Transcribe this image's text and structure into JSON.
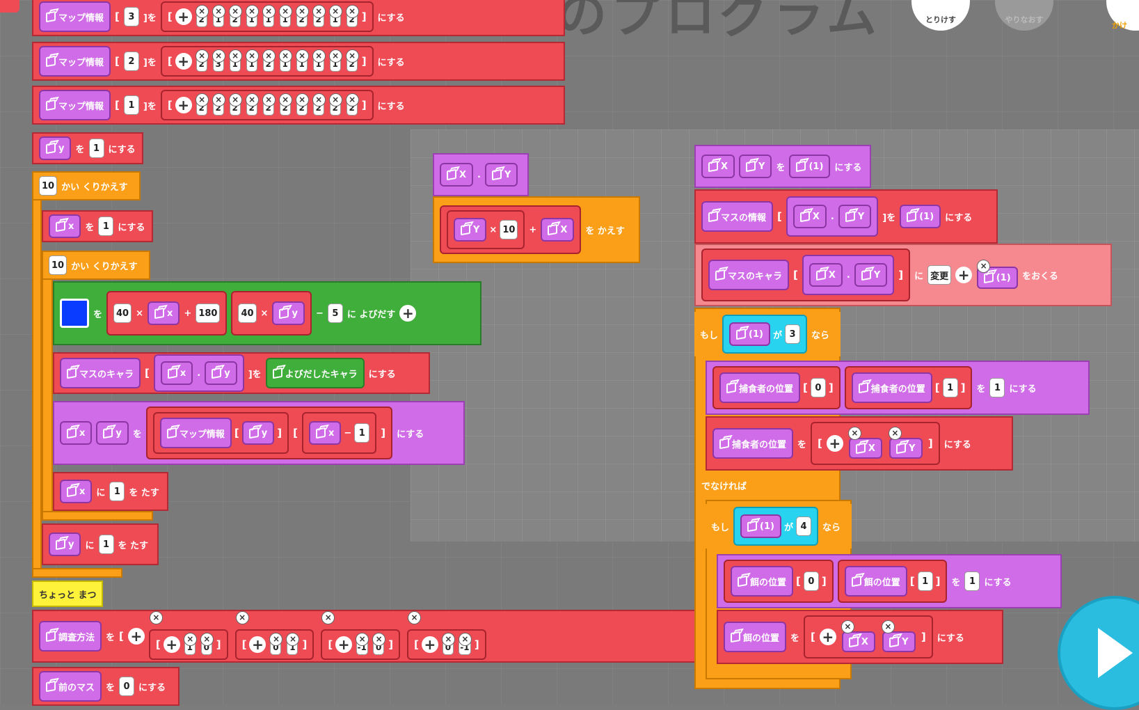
{
  "header": {
    "title": "のプログラム",
    "undo_label": "とりけす",
    "redo_label": "やりなおす",
    "right_label": "かけ"
  },
  "labels": {
    "map_info": "マップ情報",
    "set_wo": "]を",
    "nisuru": "にする",
    "repeat": "かい くりかえす",
    "wo": "を",
    "ni": "に",
    "wo_tasu": "を たす",
    "yobidasu": "に よびだす",
    "masu_chara": "マスのキャラ",
    "yobidashita": "よびだしたキャラ",
    "wait": "ちょっと まつ",
    "search": "調査方法",
    "prev_masu": "前のマス",
    "return": "を かえす",
    "masu_info": "マスの情報",
    "change": "変更",
    "okuru": "をおくる",
    "moshi": "もし",
    "ga": "が",
    "nara": "なら",
    "else": "でなければ",
    "predator": "捕食者の位置",
    "food": "餌の位置",
    "arg1": "(1)",
    "times": "×",
    "plusop": "+",
    "minusop": "−",
    "dot": "."
  },
  "vars": {
    "x": "x",
    "y": "y",
    "X": "X",
    "Y": "Y"
  },
  "map_rows": [
    {
      "index": "3",
      "values": [
        "2",
        "1",
        "2",
        "1",
        "1",
        "1",
        "2",
        "2",
        "1",
        "2"
      ]
    },
    {
      "index": "2",
      "values": [
        "2",
        "3",
        "1",
        "1",
        "2",
        "1",
        "1",
        "1",
        "1",
        "2"
      ]
    },
    {
      "index": "1",
      "values": [
        "2",
        "2",
        "2",
        "2",
        "2",
        "2",
        "2",
        "2",
        "2",
        "2"
      ]
    }
  ],
  "left_program": {
    "y_init": "1",
    "outer_count": "10",
    "x_init": "1",
    "inner_count": "10",
    "call_x_mul": "40",
    "call_x_add": "180",
    "call_y_mul": "40",
    "call_y_sub": "5",
    "map_x_sub": "1",
    "x_inc": "1",
    "y_inc": "1",
    "prev_value": "0",
    "swatch_color": "#0a3cff"
  },
  "search_dirs": [
    [
      "1",
      "0"
    ],
    [
      "0",
      "1"
    ],
    [
      "-1",
      "0"
    ],
    [
      "0",
      "-1"
    ]
  ],
  "func_mid": {
    "mul": "10"
  },
  "right_program": {
    "cond1": "3",
    "cond2": "4",
    "pred_idx0": "0",
    "pred_idx1": "1",
    "pred_val": "1",
    "food_idx0": "0",
    "food_idx1": "1",
    "food_val": "1"
  }
}
